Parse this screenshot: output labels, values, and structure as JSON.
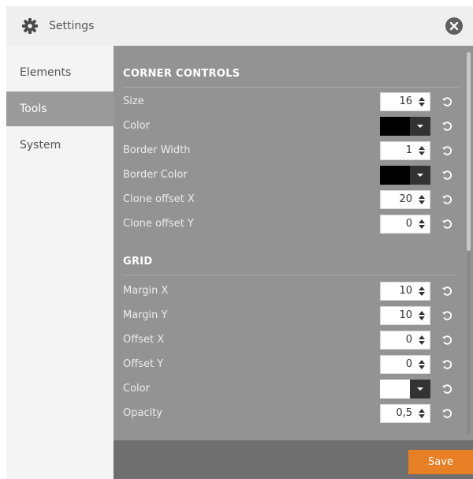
{
  "dialog": {
    "title": "Settings",
    "title_icon": "gear-icon",
    "close_icon": "close-icon"
  },
  "sidebar": {
    "items": [
      {
        "label": "Elements",
        "active": false
      },
      {
        "label": "Tools",
        "active": true
      },
      {
        "label": "System",
        "active": false
      }
    ]
  },
  "sections": {
    "corner": {
      "title": "CORNER CONTROLS",
      "rows": [
        {
          "label": "Size",
          "type": "number",
          "value": "16"
        },
        {
          "label": "Color",
          "type": "color",
          "value": "#000000"
        },
        {
          "label": "Border Width",
          "type": "number",
          "value": "1"
        },
        {
          "label": "Border Color",
          "type": "color",
          "value": "#000000"
        },
        {
          "label": "Clone offset X",
          "type": "number",
          "value": "20"
        },
        {
          "label": "Clone offset Y",
          "type": "number",
          "value": "0"
        }
      ]
    },
    "grid": {
      "title": "GRID",
      "rows": [
        {
          "label": "Margin X",
          "type": "number",
          "value": "10"
        },
        {
          "label": "Margin Y",
          "type": "number",
          "value": "10"
        },
        {
          "label": "Offset X",
          "type": "number",
          "value": "0"
        },
        {
          "label": "Offset Y",
          "type": "number",
          "value": "0"
        },
        {
          "label": "Color",
          "type": "color",
          "value": "#ffffff"
        },
        {
          "label": "Opacity",
          "type": "number",
          "value": "0,5"
        }
      ]
    }
  },
  "footer": {
    "save_label": "Save"
  },
  "colors": {
    "accent": "#e77f24",
    "panel": "#939393",
    "sidebar_active": "#9a9a9a",
    "footer": "#6f6f6f"
  },
  "icons": {
    "reset": "reset-icon",
    "spinner": "spinner-icon",
    "dropdown": "dropdown-arrow-icon"
  }
}
